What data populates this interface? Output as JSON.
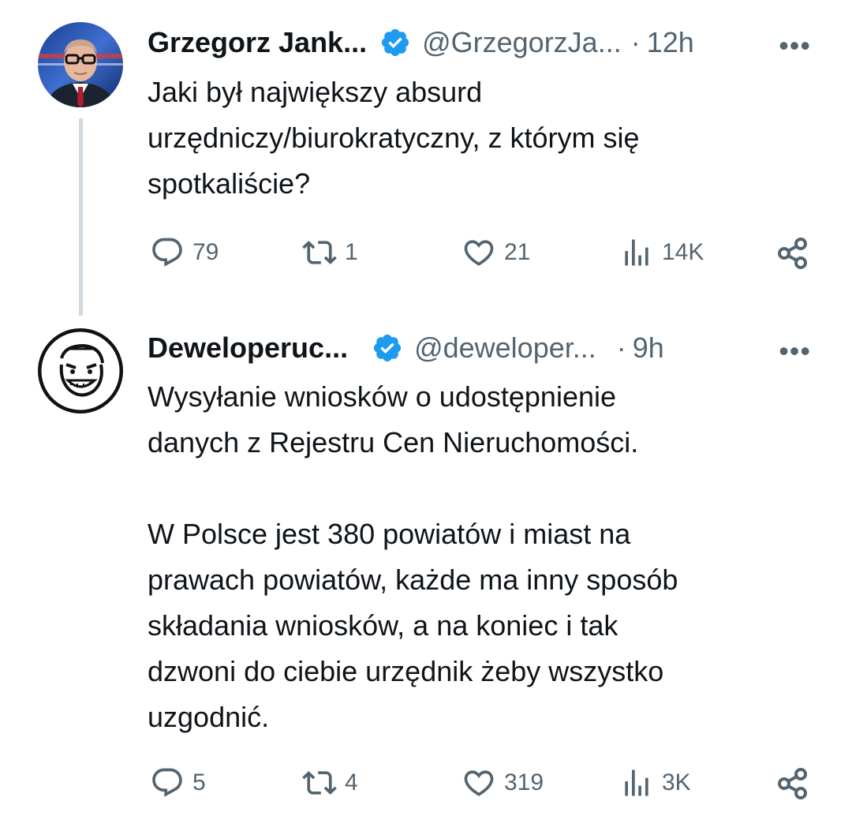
{
  "tweets": [
    {
      "author_name": "Grzegorz Jank...",
      "handle": "@GrzegorzJa...",
      "separator": "·",
      "time": "12h",
      "more": "•••",
      "text": "Jaki był największy absurd\nurzędniczy/biurokratyczny, z którym się\nspotkaliście?",
      "replies": "79",
      "reposts": "1",
      "likes": "21",
      "views": "14K"
    },
    {
      "author_name": "Deweloperuc...",
      "handle": "@deweloper...",
      "separator": "·",
      "time": "9h",
      "more": "•••",
      "text": "Wysyłanie wniosków o udostępnienie\ndanych z Rejestru Cen Nieruchomości.\n\nW Polsce jest 380 powiatów i miast na\nprawach powiatów, każde ma inny sposób\nskładania wniosków, a na koniec i tak\ndzwoni do ciebie urzędnik żeby wszystko\nuzgodnić.",
      "replies": "5",
      "reposts": "4",
      "likes": "319",
      "views": "3K"
    }
  ],
  "icons": {
    "verified": "verified-badge-icon",
    "reply": "reply-icon",
    "repost": "repost-icon",
    "like": "like-icon",
    "views": "views-icon",
    "share": "share-icon"
  },
  "colors": {
    "verified_blue": "#1d9bf0",
    "secondary_text": "#536471",
    "primary_text": "#0f1419",
    "thread_line": "#cfd9de"
  }
}
